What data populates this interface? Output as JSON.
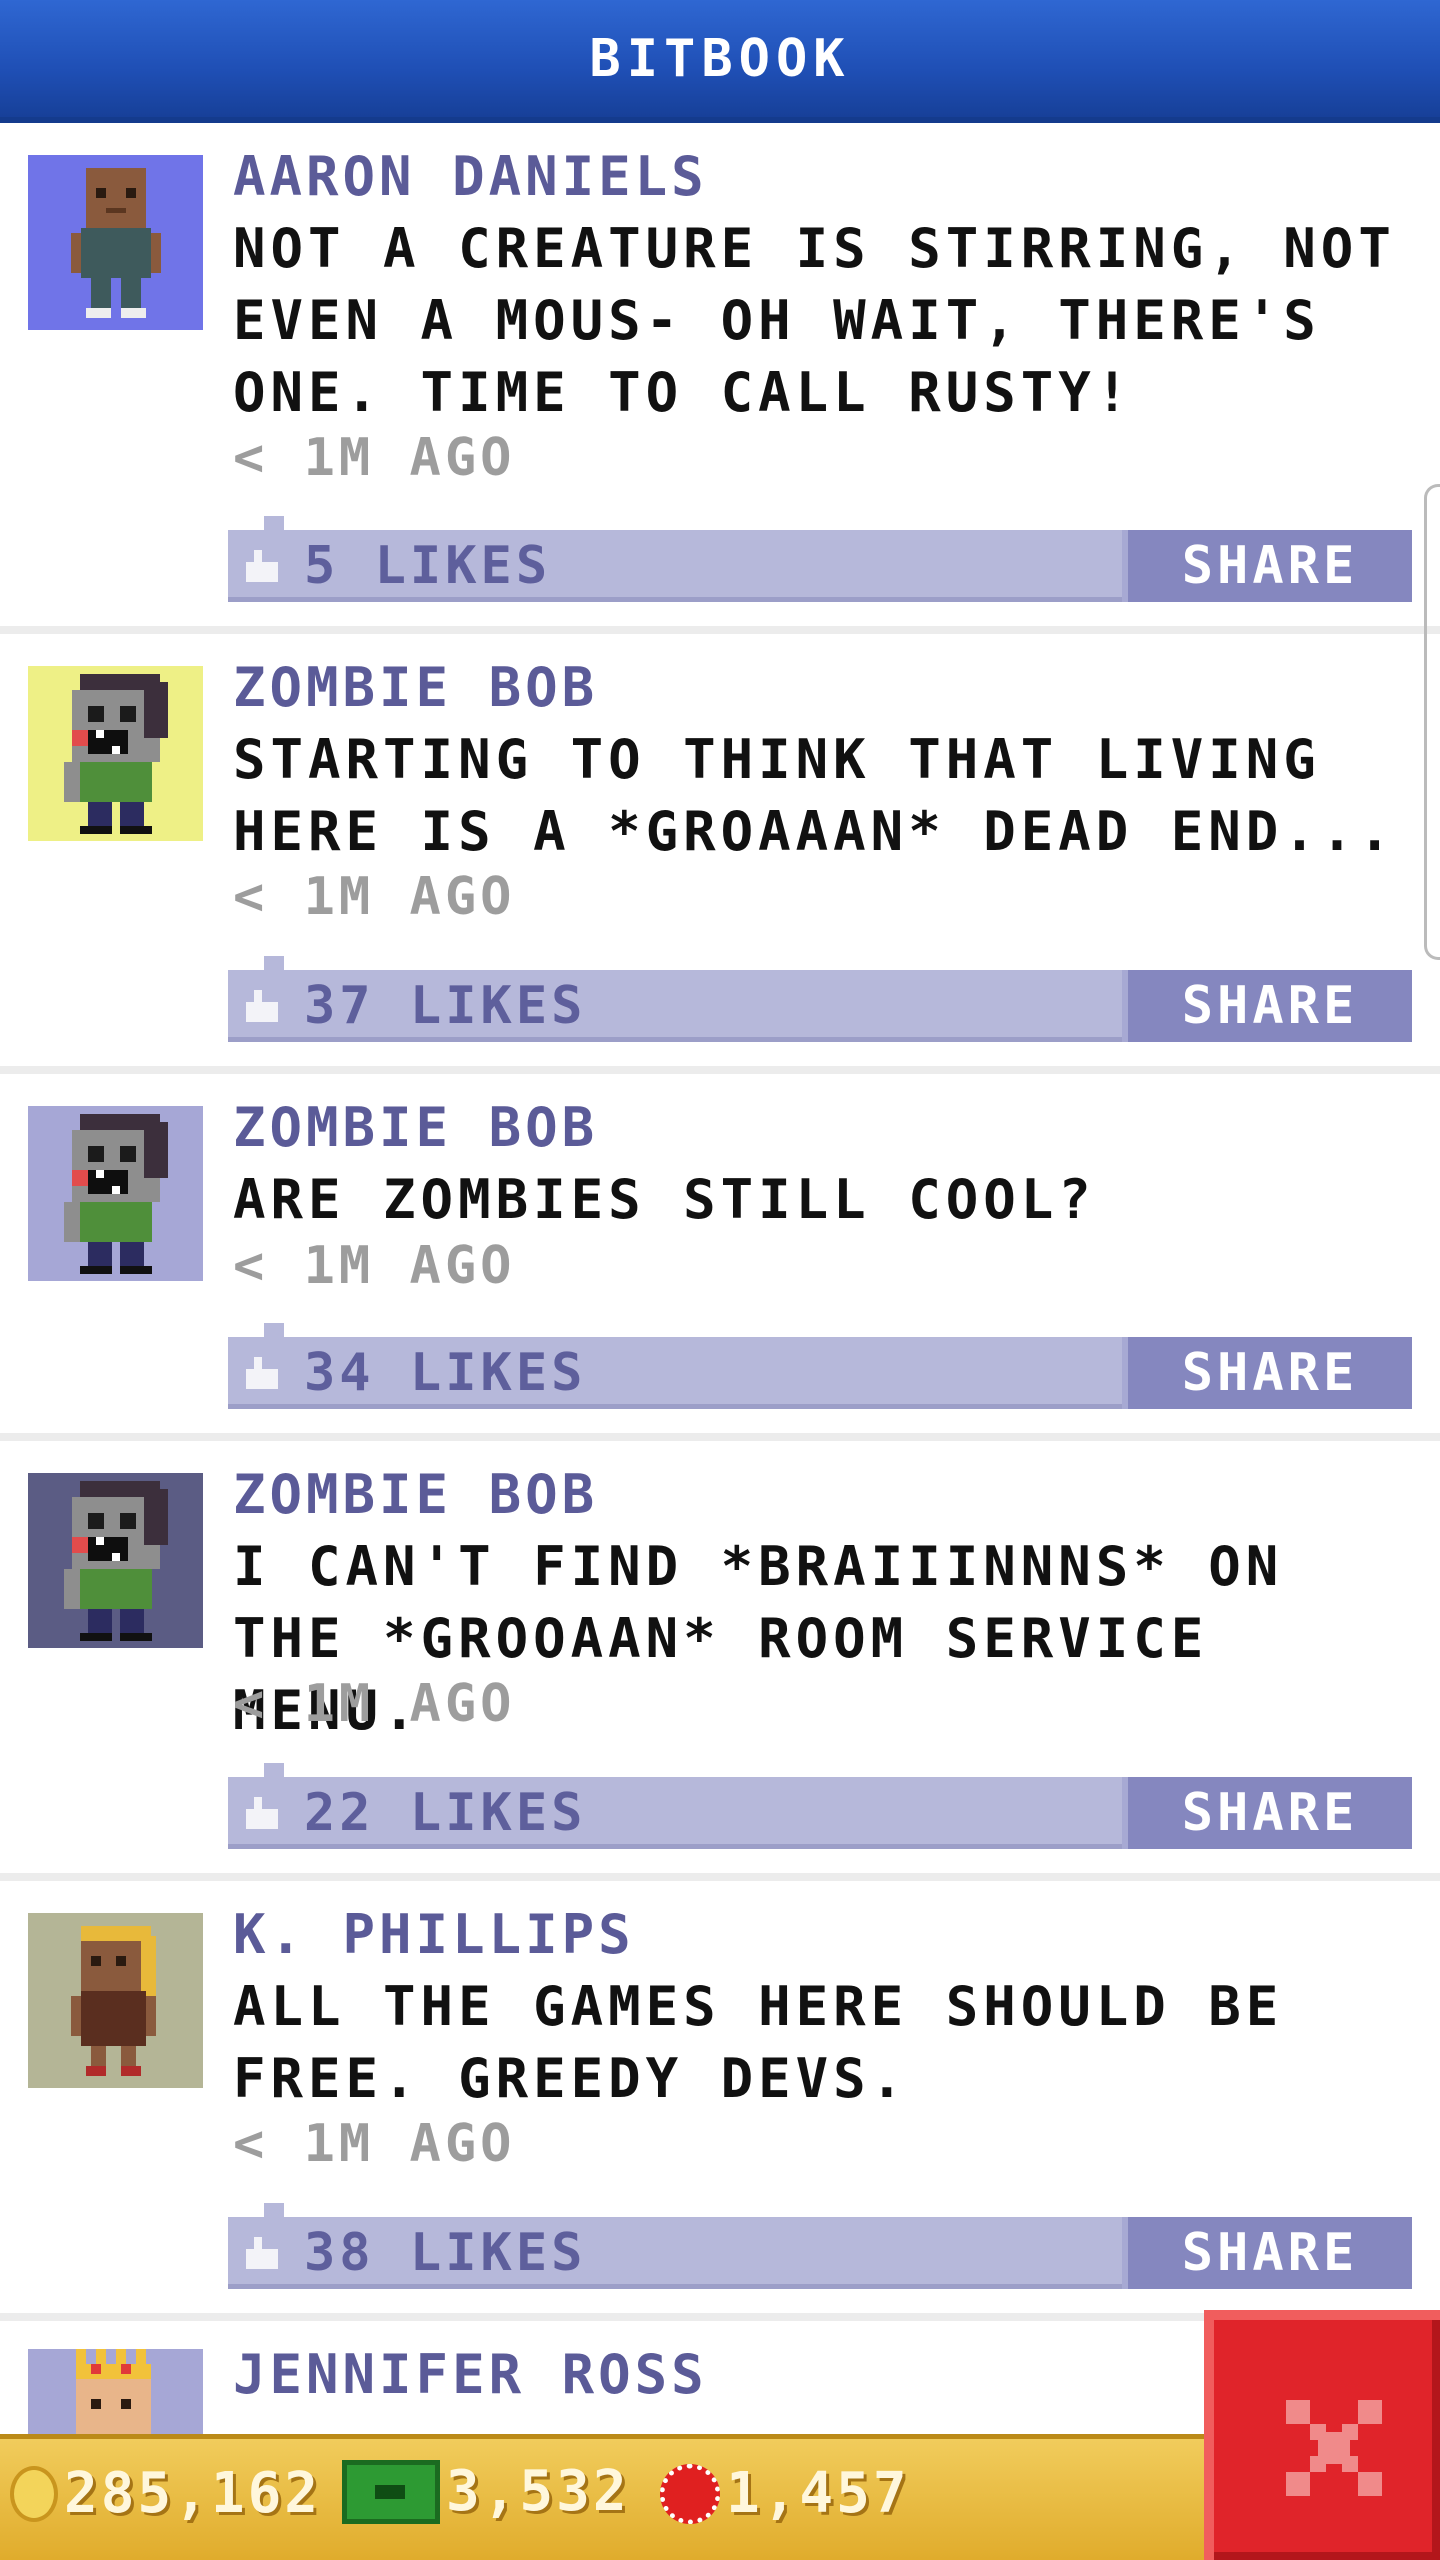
{
  "header": {
    "title": "BITBOOK"
  },
  "posts": [
    {
      "author": "AARON DANIELS",
      "message": "NOT A CREATURE IS STIRRING, NOT EVEN A MOUS- OH WAIT, THERE'S ONE. TIME TO CALL RUSTY!",
      "time": "< 1M AGO",
      "likes": "5 LIKES",
      "share": "SHARE",
      "avatar_bg": "#7074e8",
      "avatar": "person-avatar-icon"
    },
    {
      "author": "ZOMBIE BOB",
      "message": "STARTING TO THINK THAT LIVING HERE IS A *GROAAAN* DEAD END...",
      "time": "< 1M AGO",
      "likes": "37 LIKES",
      "share": "SHARE",
      "avatar_bg": "#eef086",
      "avatar": "zombie-avatar-icon"
    },
    {
      "author": "ZOMBIE BOB",
      "message": "ARE ZOMBIES STILL COOL?",
      "time": "< 1M AGO",
      "likes": "34 LIKES",
      "share": "SHARE",
      "avatar_bg": "#a6a7d6",
      "avatar": "zombie-avatar-icon"
    },
    {
      "author": "ZOMBIE BOB",
      "message": "I CAN'T FIND *BRAIIINNNS* ON THE *GROOAAN* ROOM SERVICE MENU.",
      "time": "< 1M AGO",
      "likes": "22 LIKES",
      "share": "SHARE",
      "avatar_bg": "#5b5c84",
      "avatar": "zombie-avatar-icon"
    },
    {
      "author": "K. PHILLIPS",
      "message": "ALL THE GAMES HERE SHOULD BE FREE. GREEDY DEVS.",
      "time": "< 1M AGO",
      "likes": "38 LIKES",
      "share": "SHARE",
      "avatar_bg": "#b4b596",
      "avatar": "person-avatar-icon"
    },
    {
      "author": "JENNIFER ROSS",
      "avatar_bg": "#a6a7d6",
      "avatar": "princess-avatar-icon"
    }
  ],
  "footer": {
    "coins": "285,162",
    "bux": "3,532",
    "cherries": "1,457"
  },
  "colors": {
    "header": "#1f4fb5",
    "like_bar": "#b6b8da",
    "share_button": "#8587bf",
    "author": "#5b5b98",
    "close": "#e0242a"
  }
}
